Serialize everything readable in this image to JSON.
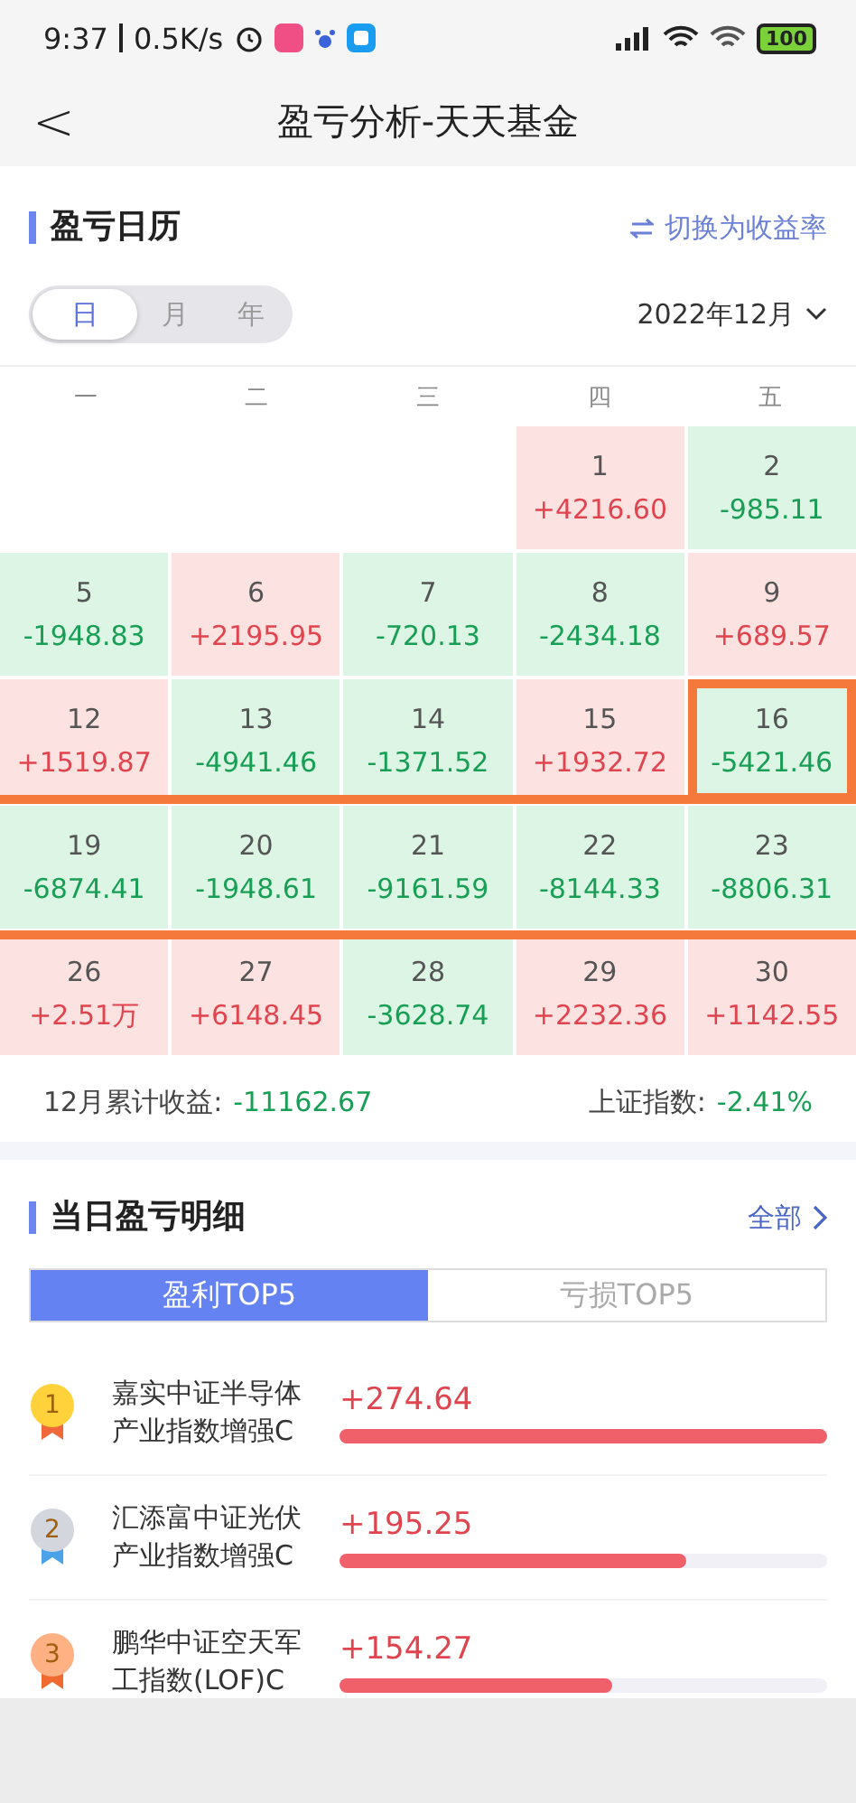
{
  "status_bar": {
    "time": "9:37",
    "speed": "0.5K/s",
    "battery": "100"
  },
  "header": {
    "back": "<",
    "title": "盈亏分析-天天基金"
  },
  "calendar_section": {
    "title": "盈亏日历",
    "switch": "切换为收益率",
    "periods": [
      {
        "label": "日",
        "selected": true
      },
      {
        "label": "月",
        "selected": false
      },
      {
        "label": "年",
        "selected": false
      }
    ],
    "month": "2022年12月",
    "weekdays": [
      "一",
      "二",
      "三",
      "四",
      "五"
    ],
    "weeks": [
      {
        "highlighted": false,
        "days": [
          {
            "kind": "empty"
          },
          {
            "kind": "empty"
          },
          {
            "kind": "empty"
          },
          {
            "day": "1",
            "value": "+4216.60",
            "kind": "gain",
            "highlighted": false
          },
          {
            "day": "2",
            "value": "-985.11",
            "kind": "loss",
            "highlighted": false
          }
        ]
      },
      {
        "highlighted": false,
        "days": [
          {
            "day": "5",
            "value": "-1948.83",
            "kind": "loss",
            "highlighted": false
          },
          {
            "day": "6",
            "value": "+2195.95",
            "kind": "gain",
            "highlighted": false
          },
          {
            "day": "7",
            "value": "-720.13",
            "kind": "loss",
            "highlighted": false
          },
          {
            "day": "8",
            "value": "-2434.18",
            "kind": "loss",
            "highlighted": false
          },
          {
            "day": "9",
            "value": "+689.57",
            "kind": "gain",
            "highlighted": false
          }
        ]
      },
      {
        "highlighted": false,
        "days": [
          {
            "day": "12",
            "value": "+1519.87",
            "kind": "gain",
            "highlighted": false
          },
          {
            "day": "13",
            "value": "-4941.46",
            "kind": "loss",
            "highlighted": false
          },
          {
            "day": "14",
            "value": "-1371.52",
            "kind": "loss",
            "highlighted": false
          },
          {
            "day": "15",
            "value": "+1932.72",
            "kind": "gain",
            "highlighted": false
          },
          {
            "day": "16",
            "value": "-5421.46",
            "kind": "loss",
            "highlighted": true
          }
        ]
      },
      {
        "highlighted": true,
        "days": [
          {
            "day": "19",
            "value": "-6874.41",
            "kind": "loss",
            "highlighted": false
          },
          {
            "day": "20",
            "value": "-1948.61",
            "kind": "loss",
            "highlighted": false
          },
          {
            "day": "21",
            "value": "-9161.59",
            "kind": "loss",
            "highlighted": false
          },
          {
            "day": "22",
            "value": "-8144.33",
            "kind": "loss",
            "highlighted": false
          },
          {
            "day": "23",
            "value": "-8806.31",
            "kind": "loss",
            "highlighted": false
          }
        ]
      },
      {
        "highlighted": false,
        "days": [
          {
            "day": "26",
            "value": "+2.51万",
            "kind": "gain",
            "highlighted": false
          },
          {
            "day": "27",
            "value": "+6148.45",
            "kind": "gain",
            "highlighted": false
          },
          {
            "day": "28",
            "value": "-3628.74",
            "kind": "loss",
            "highlighted": false
          },
          {
            "day": "29",
            "value": "+2232.36",
            "kind": "gain",
            "highlighted": false
          },
          {
            "day": "30",
            "value": "+1142.55",
            "kind": "gain",
            "highlighted": false
          }
        ]
      }
    ],
    "summary": [
      {
        "label": "12月累计收益:",
        "value": "-11162.67",
        "kind": "loss"
      },
      {
        "label": "上证指数:",
        "value": "-2.41%",
        "kind": "loss"
      }
    ]
  },
  "detail_section": {
    "title": "当日盈亏明细",
    "more": "全部",
    "tabs": [
      {
        "label": "盈利TOP5",
        "selected": true
      },
      {
        "label": "亏损TOP5",
        "selected": false
      }
    ],
    "items": [
      {
        "rank": "1",
        "color": "#ffd23c",
        "name": "嘉实中证半导体产业指数增强C",
        "value": "+274.64",
        "level": 1
      },
      {
        "rank": "2",
        "color": "#d3d6dc",
        "name": "汇添富中证光伏产业指数增强C",
        "value": "+195.25",
        "level": 0.71
      },
      {
        "rank": "3",
        "color": "#ffb184",
        "name": "鹏华中证空天军工指数(LOF)C",
        "value": "+154.27",
        "level": 0.56
      }
    ]
  }
}
